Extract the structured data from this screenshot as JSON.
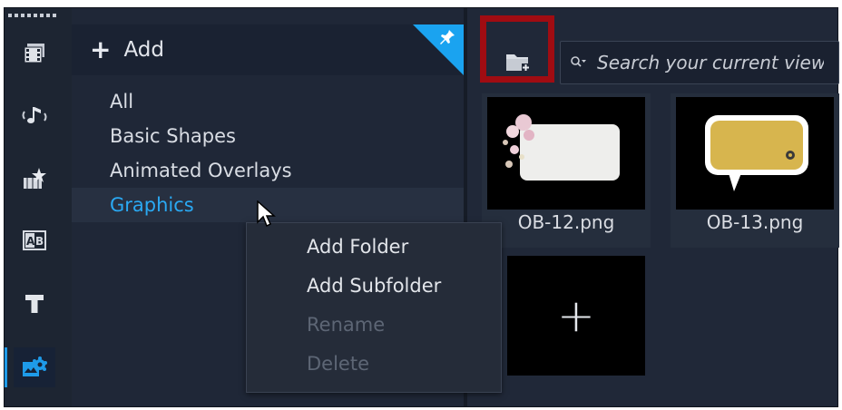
{
  "sidebar": {
    "items": [
      {
        "name": "media-library",
        "icon": "film-strip-icon",
        "active": false
      },
      {
        "name": "audio",
        "icon": "music-note-icon",
        "active": false
      },
      {
        "name": "transitions",
        "icon": "transition-icon",
        "active": false
      },
      {
        "name": "titles-ab",
        "icon": "ab-icon",
        "active": false
      },
      {
        "name": "titles",
        "icon": "text-t-icon",
        "active": false
      },
      {
        "name": "graphics",
        "icon": "graphics-puzzle-icon",
        "active": true
      }
    ]
  },
  "library": {
    "add_label": "Add",
    "folders": [
      {
        "label": "All",
        "selected": false
      },
      {
        "label": "Basic Shapes",
        "selected": false
      },
      {
        "label": "Animated Overlays",
        "selected": false
      },
      {
        "label": "Graphics",
        "selected": true
      }
    ]
  },
  "content": {
    "search_placeholder": "Search your current view",
    "thumbnails": [
      {
        "label": "OB-12.png"
      },
      {
        "label": "OB-13.png"
      }
    ],
    "add_tile_label": "+"
  },
  "context_menu": {
    "items": [
      {
        "label": "Add Folder",
        "enabled": true
      },
      {
        "label": "Add Subfolder",
        "enabled": true
      },
      {
        "label": "Rename",
        "enabled": false
      },
      {
        "label": "Delete",
        "enabled": false
      }
    ]
  },
  "colors": {
    "accent": "#1e9be9",
    "highlight": "#a00c12",
    "selected_text": "#2aa9f3"
  }
}
